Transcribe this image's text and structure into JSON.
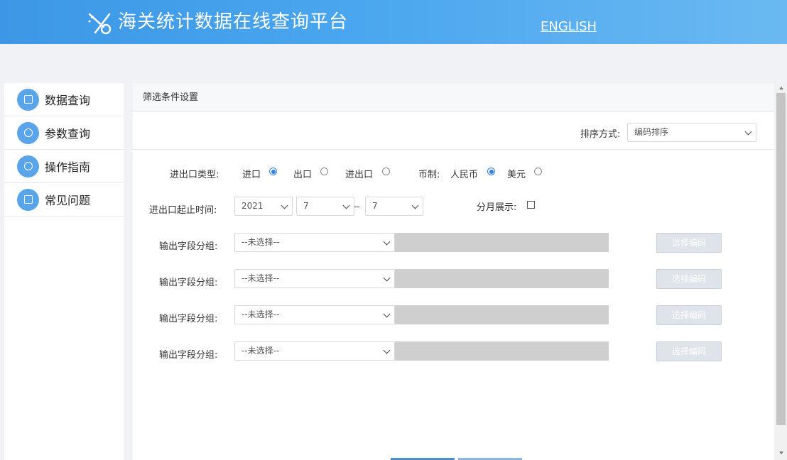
{
  "header": {
    "title": "海关统计数据在线查询平台",
    "english_link": "ENGLISH"
  },
  "sidebar": {
    "items": [
      {
        "label": "数据查询",
        "icon": "document-search-icon"
      },
      {
        "label": "参数查询",
        "icon": "magnifier-icon"
      },
      {
        "label": "操作指南",
        "icon": "hand-icon"
      },
      {
        "label": "常见问题",
        "icon": "table-icon"
      }
    ]
  },
  "panel": {
    "title": "筛选条件设置",
    "sort": {
      "label": "排序方式:",
      "value": "编码排序"
    },
    "trade_type": {
      "label": "进出口类型:",
      "options": [
        "进口",
        "出口",
        "进出口"
      ],
      "selected": "进口"
    },
    "currency": {
      "label": "币制:",
      "options": [
        "人民币",
        "美元"
      ],
      "selected": "人民币"
    },
    "period": {
      "label": "进出口起止时间:",
      "year": "2021",
      "month_from": "7",
      "separator": "--",
      "month_to": "7"
    },
    "monthly": {
      "label": "分月展示:",
      "checked": false
    },
    "output_groups": [
      {
        "label": "输出字段分组:",
        "select": "--未选择--",
        "button": "选择编码"
      },
      {
        "label": "输出字段分组:",
        "select": "--未选择--",
        "button": "选择编码"
      },
      {
        "label": "输出字段分组:",
        "select": "--未选择--",
        "button": "选择编码"
      },
      {
        "label": "输出字段分组:",
        "select": "--未选择--",
        "button": "选择编码"
      }
    ]
  },
  "colors": {
    "header_blue": "#3d97e6",
    "icon_blue": "#5aa5ea",
    "radio_blue": "#2f7fe0",
    "disabled_gray": "#cfcfcf"
  }
}
